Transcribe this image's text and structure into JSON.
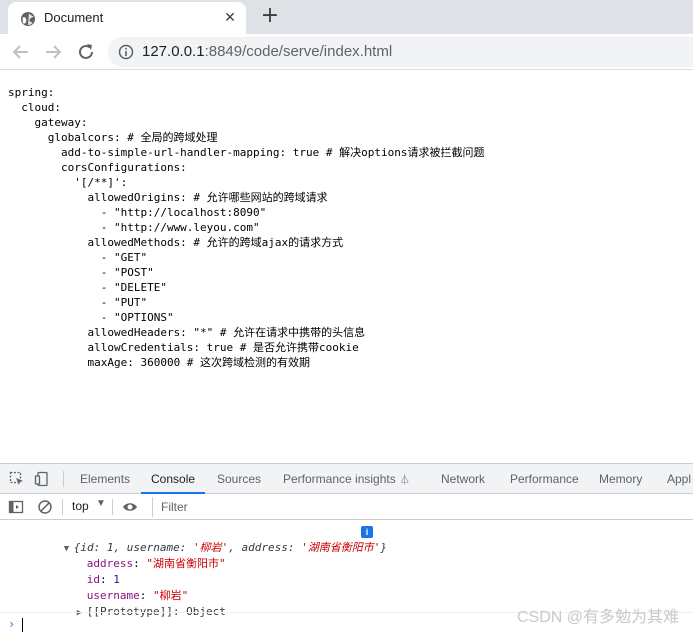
{
  "browser": {
    "tab_title": "Document",
    "url_host": "127.0.0.1",
    "url_rest": ":8849/code/serve/index.html"
  },
  "page": {
    "lines": [
      "spring:",
      "  cloud:",
      "    gateway:",
      "      globalcors: # 全局的跨域处理",
      "        add-to-simple-url-handler-mapping: true # 解决options请求被拦截问题",
      "        corsConfigurations:",
      "          '[/**]':",
      "            allowedOrigins: # 允许哪些网站的跨域请求",
      "              - \"http://localhost:8090\"",
      "              - \"http://www.leyou.com\"",
      "            allowedMethods: # 允许的跨域ajax的请求方式",
      "              - \"GET\"",
      "              - \"POST\"",
      "              - \"DELETE\"",
      "              - \"PUT\"",
      "              - \"OPTIONS\"",
      "            allowedHeaders: \"*\" # 允许在请求中携带的头信息",
      "            allowCredentials: true # 是否允许携带cookie",
      "            maxAge: 360000 # 这次跨域检测的有效期"
    ]
  },
  "devtools": {
    "tabs": [
      "Elements",
      "Console",
      "Sources",
      "Performance insights",
      "Network",
      "Performance",
      "Memory",
      "Appl"
    ],
    "active_tab": "Console",
    "context": "top",
    "filter_placeholder": "Filter",
    "log": {
      "summary_open": "{id: 1, username: ",
      "summary_username": "'柳岩'",
      "summary_mid": ", address: ",
      "summary_address": "'湖南省衡阳市'",
      "summary_close": "}",
      "info_badge": "i",
      "props": [
        {
          "key": "address",
          "value": "\"湖南省衡阳市\"",
          "kind": "string"
        },
        {
          "key": "id",
          "value": "1",
          "kind": "number"
        },
        {
          "key": "username",
          "value": "\"柳岩\"",
          "kind": "string"
        }
      ],
      "prototype": "[[Prototype]]: Object"
    }
  },
  "watermark": "CSDN @有多勉为其难"
}
